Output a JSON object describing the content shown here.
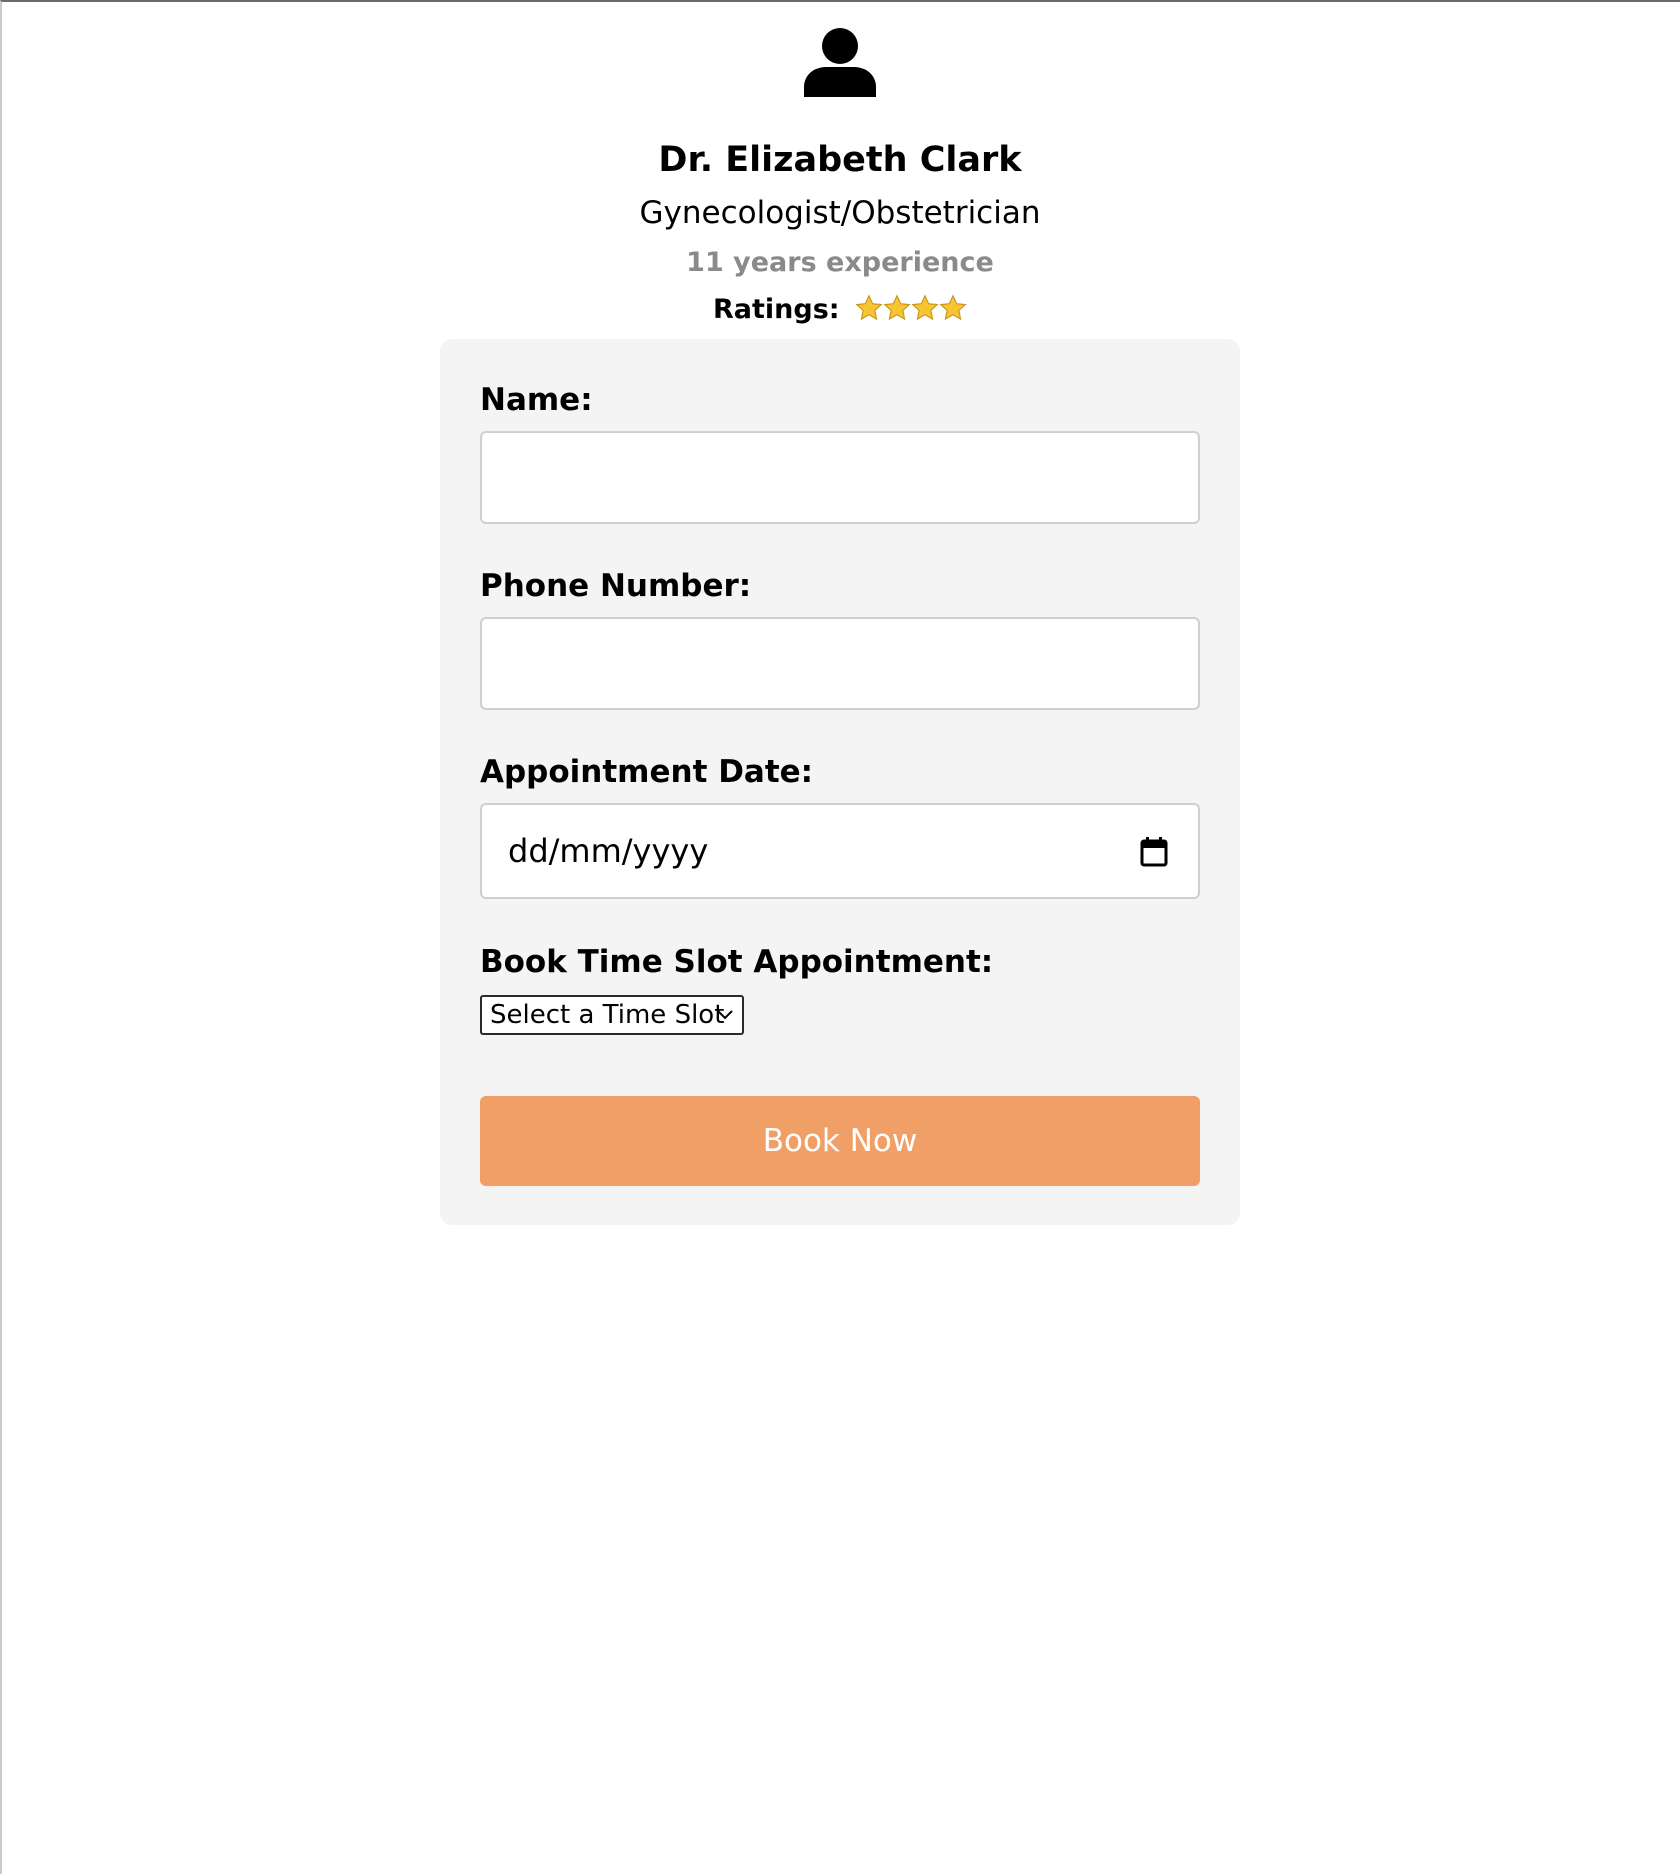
{
  "doctor": {
    "name": "Dr. Elizabeth Clark",
    "specialty": "Gynecologist/Obstetrician",
    "experience": "11 years experience",
    "ratings_label": "Ratings:",
    "rating_stars": 4,
    "avatar_icon": "user-icon"
  },
  "form": {
    "name_label": "Name:",
    "name_value": "",
    "phone_label": "Phone Number:",
    "phone_value": "",
    "date_label": "Appointment Date:",
    "date_placeholder": "dd/mm/yyyy",
    "calendar_icon": "calendar-icon",
    "time_label": "Book Time Slot Appointment:",
    "time_selected": "Select a Time Slot",
    "book_button": "Book Now"
  },
  "colors": {
    "card_background": "#f4f4f4",
    "button": "#f0a066",
    "experience_text": "#8a8a8a",
    "star": "#f7c531"
  }
}
